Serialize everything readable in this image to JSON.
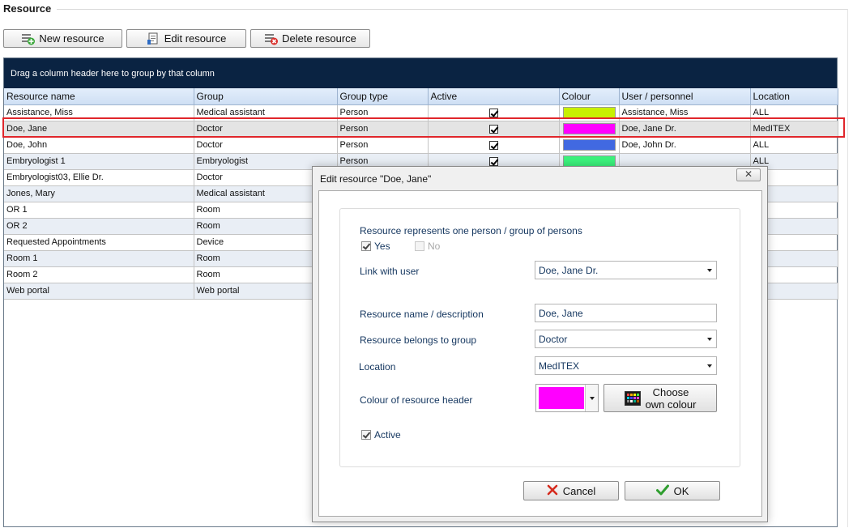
{
  "section": {
    "title": "Resource"
  },
  "toolbar": {
    "new_label": "New resource",
    "edit_label": "Edit resource",
    "delete_label": "Delete resource"
  },
  "grid": {
    "group_hint": "Drag a column header here to group by that column",
    "columns": [
      "Resource name",
      "Group",
      "Group type",
      "Active",
      "Colour",
      "User / personnel",
      "Location"
    ],
    "rows": [
      {
        "name": "Assistance, Miss",
        "group": "Medical assistant",
        "type": "Person",
        "active": true,
        "colour": "#c8f000",
        "user": "Assistance, Miss",
        "location": "ALL"
      },
      {
        "name": "Doe, Jane",
        "group": "Doctor",
        "type": "Person",
        "active": true,
        "colour": "#ff00ff",
        "user": "Doe, Jane Dr.",
        "location": "MedITEX"
      },
      {
        "name": "Doe, John",
        "group": "Doctor",
        "type": "Person",
        "active": true,
        "colour": "#4169e1",
        "user": "Doe, John Dr.",
        "location": "ALL"
      },
      {
        "name": "Embryologist 1",
        "group": "Embryologist",
        "type": "Person",
        "active": true,
        "colour": "#3cf27c",
        "user": "",
        "location": "ALL"
      },
      {
        "name": "Embryologist03, Ellie Dr.",
        "group": "Doctor",
        "type": "",
        "active": null,
        "colour": "",
        "user": "",
        "location": ""
      },
      {
        "name": "Jones, Mary",
        "group": "Medical assistant",
        "type": "",
        "active": null,
        "colour": "",
        "user": "",
        "location": ""
      },
      {
        "name": "OR 1",
        "group": "Room",
        "type": "",
        "active": null,
        "colour": "",
        "user": "",
        "location": ""
      },
      {
        "name": "OR 2",
        "group": "Room",
        "type": "",
        "active": null,
        "colour": "",
        "user": "",
        "location": ""
      },
      {
        "name": "Requested Appointments",
        "group": "Device",
        "type": "",
        "active": null,
        "colour": "",
        "user": "",
        "location": ""
      },
      {
        "name": "Room 1",
        "group": "Room",
        "type": "",
        "active": null,
        "colour": "",
        "user": "",
        "location": ""
      },
      {
        "name": "Room 2",
        "group": "Room",
        "type": "",
        "active": null,
        "colour": "",
        "user": "",
        "location": ""
      },
      {
        "name": "Web portal",
        "group": "Web portal",
        "type": "",
        "active": null,
        "colour": "",
        "user": "",
        "location": ""
      }
    ]
  },
  "dialog": {
    "title": "Edit resource \"Doe, Jane\"",
    "close_glyph": "✕",
    "represents_label": "Resource represents one person / group of persons",
    "yes_label": "Yes",
    "no_label": "No",
    "link_user_label": "Link with user",
    "link_user_value": "Doe, Jane Dr.",
    "name_label": "Resource name / description",
    "name_value": "Doe, Jane",
    "group_label": "Resource belongs to group",
    "group_value": "Doctor",
    "location_label": "Location",
    "location_value": "MedITEX",
    "colour_label": "Colour of resource header",
    "colour_value": "#ff00ff",
    "choose_line1": "Choose",
    "choose_line2": "own colour",
    "active_label": "Active",
    "cancel_label": "Cancel",
    "ok_label": "OK"
  },
  "icons": {
    "new": "add-icon",
    "edit": "edit-document-icon",
    "delete": "delete-icon",
    "palette": "palette-icon",
    "cancel": "red-x-icon",
    "ok": "green-check-icon"
  },
  "colors": {
    "group_panel": "#0a2342",
    "selection_outline": "#e0262b",
    "label_text": "#14365f"
  }
}
